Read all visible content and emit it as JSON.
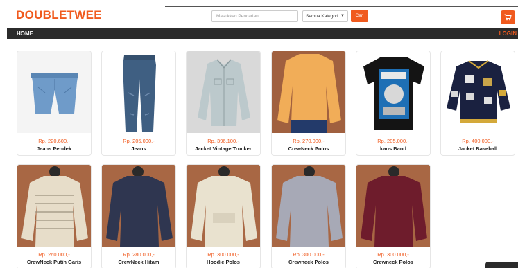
{
  "header": {
    "brand": "DOUBLETWEE",
    "search_placeholder": "Masukkan Pencarian",
    "category_selected": "Semua Kategori",
    "search_button": "Cari",
    "cart_icon": "cart-icon"
  },
  "nav": {
    "home": "HOME",
    "login": "LOGIN"
  },
  "colors": {
    "accent": "#f05a1e",
    "navbar": "#2b2b2b"
  },
  "products": [
    {
      "price": "Rp. 220.600,-",
      "name": "Jeans Pendek"
    },
    {
      "price": "Rp. 205.000,-",
      "name": "Jeans"
    },
    {
      "price": "Rp. 396.100,-",
      "name": "Jacket Vintage Trucker"
    },
    {
      "price": "Rp. 270.000,-",
      "name": "CrewNeck Polos"
    },
    {
      "price": "Rp. 205.000,-",
      "name": "kaos Band"
    },
    {
      "price": "Rp. 400.000,-",
      "name": "Jacket Baseball"
    },
    {
      "price": "Rp. 260.000,-",
      "name": "CrewNeck Putih Garis"
    },
    {
      "price": "Rp. 280.000,-",
      "name": "CrewNeck Hitam"
    },
    {
      "price": "Rp. 300.000,-",
      "name": "Hoodie Polos"
    },
    {
      "price": "Rp. 300.000,-",
      "name": "Crewneck Polos"
    },
    {
      "price": "Rp. 300.000,-",
      "name": "Crewneck Polos"
    }
  ]
}
